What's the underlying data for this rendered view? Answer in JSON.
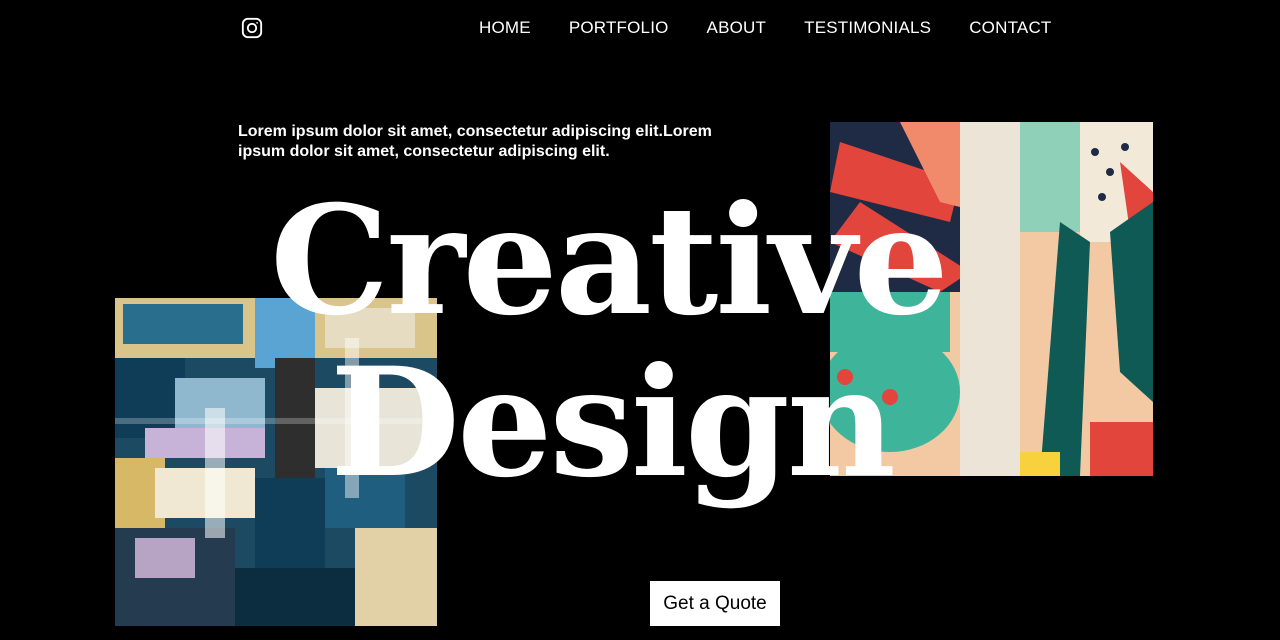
{
  "header": {
    "social_icon": "instagram-icon",
    "nav": [
      {
        "label": "HOME"
      },
      {
        "label": "PORTFOLIO"
      },
      {
        "label": "ABOUT"
      },
      {
        "label": "TESTIMONIALS"
      },
      {
        "label": "CONTACT"
      }
    ]
  },
  "hero": {
    "intro": "Lorem ipsum dolor sit amet, consectetur adipiscing elit.Lorem ipsum dolor sit amet, consectetur adipiscing elit.",
    "headline_line_1": "Creative",
    "headline_line_2": "Design",
    "cta_label": "Get a Quote"
  },
  "colors": {
    "background": "#000000",
    "text": "#ffffff",
    "button_bg": "#ffffff",
    "button_text": "#000000"
  }
}
